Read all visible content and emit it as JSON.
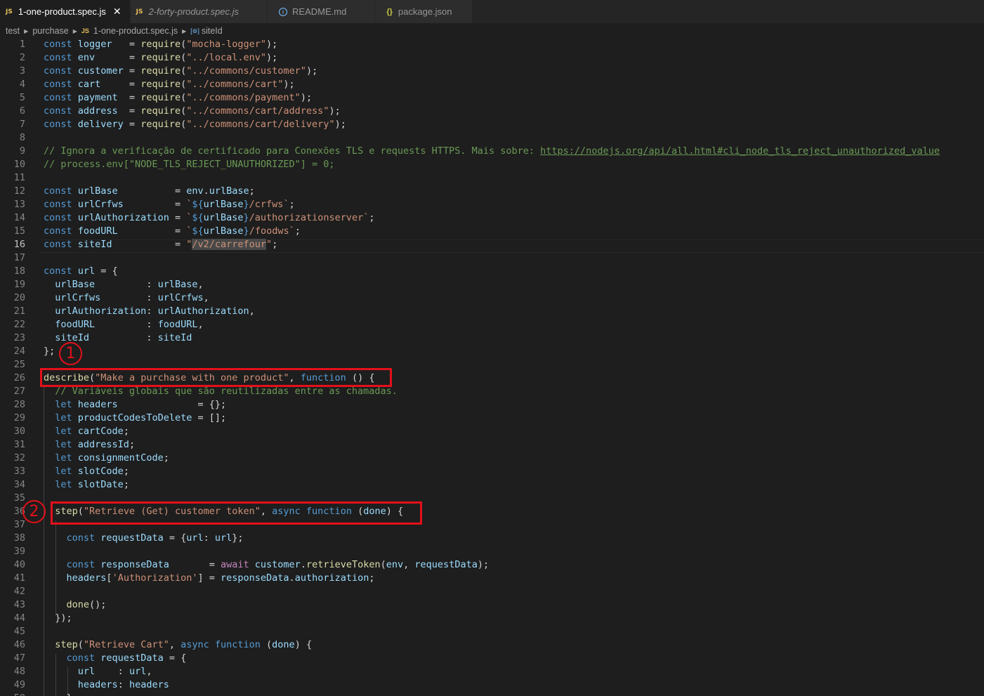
{
  "tabs": [
    {
      "label": "1-one-product.spec.js",
      "icon": "JS",
      "close": "✕"
    },
    {
      "label": "2-forty-product.spec.js",
      "icon": "JS"
    },
    {
      "label": "README.md",
      "icon": "i"
    },
    {
      "label": "package.json",
      "icon": "{}"
    }
  ],
  "breadcrumb": {
    "folder1": "test",
    "folder2": "purchase",
    "file_icon": "JS",
    "file": "1-one-product.spec.js",
    "symbol": "siteId"
  },
  "annotations": {
    "badge1": "1",
    "badge2": "2"
  },
  "editor": {
    "current_line": "16",
    "lines": [
      {
        "n": "1",
        "t": [
          [
            "kw",
            "const "
          ],
          [
            "var",
            "logger"
          ],
          [
            "",
            "   = "
          ],
          [
            "fn",
            "require"
          ],
          [
            "",
            "("
          ],
          [
            "st",
            "\"mocha-logger\""
          ],
          [
            "",
            "); "
          ]
        ]
      },
      {
        "n": "2",
        "t": [
          [
            "kw",
            "const "
          ],
          [
            "var",
            "env"
          ],
          [
            "",
            "      = "
          ],
          [
            "fn",
            "require"
          ],
          [
            "",
            "("
          ],
          [
            "st",
            "\"../local.env\""
          ],
          [
            "",
            ");"
          ]
        ]
      },
      {
        "n": "3",
        "t": [
          [
            "kw",
            "const "
          ],
          [
            "var",
            "customer"
          ],
          [
            "",
            " = "
          ],
          [
            "fn",
            "require"
          ],
          [
            "",
            "("
          ],
          [
            "st",
            "\"../commons/customer\""
          ],
          [
            "",
            ");"
          ]
        ]
      },
      {
        "n": "4",
        "t": [
          [
            "kw",
            "const "
          ],
          [
            "var",
            "cart"
          ],
          [
            "",
            "     = "
          ],
          [
            "fn",
            "require"
          ],
          [
            "",
            "("
          ],
          [
            "st",
            "\"../commons/cart\""
          ],
          [
            "",
            ");"
          ]
        ]
      },
      {
        "n": "5",
        "t": [
          [
            "kw",
            "const "
          ],
          [
            "var",
            "payment"
          ],
          [
            "",
            "  = "
          ],
          [
            "fn",
            "require"
          ],
          [
            "",
            "("
          ],
          [
            "st",
            "\"../commons/payment\""
          ],
          [
            "",
            ");"
          ]
        ]
      },
      {
        "n": "6",
        "t": [
          [
            "kw",
            "const "
          ],
          [
            "var",
            "address"
          ],
          [
            "",
            "  = "
          ],
          [
            "fn",
            "require"
          ],
          [
            "",
            "("
          ],
          [
            "st",
            "\"../commons/cart/address\""
          ],
          [
            "",
            ");"
          ]
        ]
      },
      {
        "n": "7",
        "t": [
          [
            "kw",
            "const "
          ],
          [
            "var",
            "delivery"
          ],
          [
            "",
            " = "
          ],
          [
            "fn",
            "require"
          ],
          [
            "",
            "("
          ],
          [
            "st",
            "\"../commons/cart/delivery\""
          ],
          [
            "",
            ");"
          ]
        ]
      },
      {
        "n": "8",
        "t": []
      },
      {
        "n": "9",
        "t": [
          [
            "cm",
            "// Ignora a verificação de certificado para Conexões TLS e requests HTTPS. Mais sobre: "
          ],
          [
            "link",
            "https://nodejs.org/api/all.html#cli_node_tls_reject_unauthorized_value"
          ]
        ]
      },
      {
        "n": "10",
        "t": [
          [
            "cm",
            "// process.env[\"NODE_TLS_REJECT_UNAUTHORIZED\"] = 0;"
          ]
        ]
      },
      {
        "n": "11",
        "t": []
      },
      {
        "n": "12",
        "t": [
          [
            "kw",
            "const "
          ],
          [
            "var",
            "urlBase"
          ],
          [
            "",
            "          = "
          ],
          [
            "var",
            "env"
          ],
          [
            "",
            "."
          ],
          [
            "var",
            "urlBase"
          ],
          [
            "",
            ";"
          ]
        ]
      },
      {
        "n": "13",
        "t": [
          [
            "kw",
            "const "
          ],
          [
            "var",
            "urlCrfws"
          ],
          [
            "",
            "         = "
          ],
          [
            "st",
            "`"
          ],
          [
            "kw",
            "${"
          ],
          [
            "var",
            "urlBase"
          ],
          [
            "kw",
            "}"
          ],
          [
            "st",
            "/crfws`"
          ],
          [
            "",
            ";"
          ]
        ]
      },
      {
        "n": "14",
        "t": [
          [
            "kw",
            "const "
          ],
          [
            "var",
            "urlAuthorization"
          ],
          [
            "",
            " = "
          ],
          [
            "st",
            "`"
          ],
          [
            "kw",
            "${"
          ],
          [
            "var",
            "urlBase"
          ],
          [
            "kw",
            "}"
          ],
          [
            "st",
            "/authorizationserver`"
          ],
          [
            "",
            ";"
          ]
        ]
      },
      {
        "n": "15",
        "t": [
          [
            "kw",
            "const "
          ],
          [
            "var",
            "foodURL"
          ],
          [
            "",
            "          = "
          ],
          [
            "st",
            "`"
          ],
          [
            "kw",
            "${"
          ],
          [
            "var",
            "urlBase"
          ],
          [
            "kw",
            "}"
          ],
          [
            "st",
            "/foodws`"
          ],
          [
            "",
            ";"
          ]
        ]
      },
      {
        "n": "16",
        "t": [
          [
            "kw",
            "const "
          ],
          [
            "var",
            "siteId"
          ],
          [
            "",
            "           = "
          ],
          [
            "st",
            "\""
          ],
          [
            "st hl",
            "/v2/carrefour"
          ],
          [
            "st",
            "\""
          ],
          [
            "",
            ";"
          ]
        ]
      },
      {
        "n": "17",
        "t": []
      },
      {
        "n": "18",
        "t": [
          [
            "kw",
            "const "
          ],
          [
            "var",
            "url"
          ],
          [
            "",
            " = {"
          ]
        ]
      },
      {
        "n": "19",
        "t": [
          [
            "",
            "  "
          ],
          [
            "var",
            "urlBase"
          ],
          [
            "",
            "         : "
          ],
          [
            "var",
            "urlBase"
          ],
          [
            "",
            ","
          ]
        ]
      },
      {
        "n": "20",
        "t": [
          [
            "",
            "  "
          ],
          [
            "var",
            "urlCrfws"
          ],
          [
            "",
            "        : "
          ],
          [
            "var",
            "urlCrfws"
          ],
          [
            "",
            ","
          ]
        ]
      },
      {
        "n": "21",
        "t": [
          [
            "",
            "  "
          ],
          [
            "var",
            "urlAuthorization"
          ],
          [
            "",
            ": "
          ],
          [
            "var",
            "urlAuthorization"
          ],
          [
            "",
            ","
          ]
        ]
      },
      {
        "n": "22",
        "t": [
          [
            "",
            "  "
          ],
          [
            "var",
            "foodURL"
          ],
          [
            "",
            "         : "
          ],
          [
            "var",
            "foodURL"
          ],
          [
            "",
            ","
          ]
        ]
      },
      {
        "n": "23",
        "t": [
          [
            "",
            "  "
          ],
          [
            "var",
            "siteId"
          ],
          [
            "",
            "          : "
          ],
          [
            "var",
            "siteId"
          ]
        ]
      },
      {
        "n": "24",
        "t": [
          [
            "",
            "};"
          ]
        ]
      },
      {
        "n": "25",
        "t": []
      },
      {
        "n": "26",
        "t": [
          [
            "fn",
            "describe"
          ],
          [
            "",
            "("
          ],
          [
            "st",
            "\"Make a purchase with one product\""
          ],
          [
            "",
            ", "
          ],
          [
            "kw",
            "function"
          ],
          [
            "",
            " () {"
          ]
        ]
      },
      {
        "n": "27",
        "t": [
          [
            "",
            "  "
          ],
          [
            "cm",
            "// Variáveis globais que são reutilizadas entre as chamadas."
          ]
        ]
      },
      {
        "n": "28",
        "t": [
          [
            "",
            "  "
          ],
          [
            "kw",
            "let "
          ],
          [
            "var",
            "headers"
          ],
          [
            "",
            "              = {};"
          ]
        ]
      },
      {
        "n": "29",
        "t": [
          [
            "",
            "  "
          ],
          [
            "kw",
            "let "
          ],
          [
            "var",
            "productCodesToDelete"
          ],
          [
            "",
            " = [];"
          ]
        ]
      },
      {
        "n": "30",
        "t": [
          [
            "",
            "  "
          ],
          [
            "kw",
            "let "
          ],
          [
            "var",
            "cartCode"
          ],
          [
            "",
            ";"
          ]
        ]
      },
      {
        "n": "31",
        "t": [
          [
            "",
            "  "
          ],
          [
            "kw",
            "let "
          ],
          [
            "var",
            "addressId"
          ],
          [
            "",
            ";"
          ]
        ]
      },
      {
        "n": "32",
        "t": [
          [
            "",
            "  "
          ],
          [
            "kw",
            "let "
          ],
          [
            "var",
            "consignmentCode"
          ],
          [
            "",
            ";"
          ]
        ]
      },
      {
        "n": "33",
        "t": [
          [
            "",
            "  "
          ],
          [
            "kw",
            "let "
          ],
          [
            "var",
            "slotCode"
          ],
          [
            "",
            ";"
          ]
        ]
      },
      {
        "n": "34",
        "t": [
          [
            "",
            "  "
          ],
          [
            "kw",
            "let "
          ],
          [
            "var",
            "slotDate"
          ],
          [
            "",
            ";"
          ]
        ]
      },
      {
        "n": "35",
        "t": []
      },
      {
        "n": "36",
        "t": [
          [
            "",
            "  "
          ],
          [
            "fn",
            "step"
          ],
          [
            "",
            "("
          ],
          [
            "st",
            "\"Retrieve (Get) customer token\""
          ],
          [
            "",
            ", "
          ],
          [
            "kw",
            "async function"
          ],
          [
            "",
            " ("
          ],
          [
            "var",
            "done"
          ],
          [
            "",
            ") {"
          ]
        ]
      },
      {
        "n": "37",
        "t": []
      },
      {
        "n": "38",
        "t": [
          [
            "",
            "    "
          ],
          [
            "kw",
            "const "
          ],
          [
            "var",
            "requestData"
          ],
          [
            "",
            " = {"
          ],
          [
            "var",
            "url"
          ],
          [
            "",
            ": "
          ],
          [
            "var",
            "url"
          ],
          [
            "",
            "};"
          ]
        ]
      },
      {
        "n": "39",
        "t": []
      },
      {
        "n": "40",
        "t": [
          [
            "",
            "    "
          ],
          [
            "kw",
            "const "
          ],
          [
            "var",
            "responseData"
          ],
          [
            "",
            "       = "
          ],
          [
            "ctl",
            "await "
          ],
          [
            "var",
            "customer"
          ],
          [
            "",
            "."
          ],
          [
            "fn",
            "retrieveToken"
          ],
          [
            "",
            "("
          ],
          [
            "var",
            "env"
          ],
          [
            "",
            ", "
          ],
          [
            "var",
            "requestData"
          ],
          [
            "",
            ");"
          ]
        ]
      },
      {
        "n": "41",
        "t": [
          [
            "",
            "    "
          ],
          [
            "var",
            "headers"
          ],
          [
            "",
            "["
          ],
          [
            "st",
            "'Authorization'"
          ],
          [
            "",
            "] = "
          ],
          [
            "var",
            "responseData"
          ],
          [
            "",
            "."
          ],
          [
            "var",
            "authorization"
          ],
          [
            "",
            ";"
          ]
        ]
      },
      {
        "n": "42",
        "t": []
      },
      {
        "n": "43",
        "t": [
          [
            "",
            "    "
          ],
          [
            "fn",
            "done"
          ],
          [
            "",
            "();"
          ]
        ]
      },
      {
        "n": "44",
        "t": [
          [
            "",
            "  });"
          ]
        ]
      },
      {
        "n": "45",
        "t": []
      },
      {
        "n": "46",
        "t": [
          [
            "",
            "  "
          ],
          [
            "fn",
            "step"
          ],
          [
            "",
            "("
          ],
          [
            "st",
            "\"Retrieve Cart\""
          ],
          [
            "",
            ", "
          ],
          [
            "kw",
            "async function"
          ],
          [
            "",
            " ("
          ],
          [
            "var",
            "done"
          ],
          [
            "",
            ") {"
          ]
        ]
      },
      {
        "n": "47",
        "t": [
          [
            "",
            "    "
          ],
          [
            "kw",
            "const "
          ],
          [
            "var",
            "requestData"
          ],
          [
            "",
            " = {"
          ]
        ]
      },
      {
        "n": "48",
        "t": [
          [
            "",
            "      "
          ],
          [
            "var",
            "url"
          ],
          [
            "",
            "    : "
          ],
          [
            "var",
            "url"
          ],
          [
            "",
            ","
          ]
        ]
      },
      {
        "n": "49",
        "t": [
          [
            "",
            "      "
          ],
          [
            "var",
            "headers"
          ],
          [
            "",
            ": "
          ],
          [
            "var",
            "headers"
          ]
        ]
      },
      {
        "n": "50",
        "t": [
          [
            "",
            "    };"
          ]
        ]
      }
    ]
  }
}
